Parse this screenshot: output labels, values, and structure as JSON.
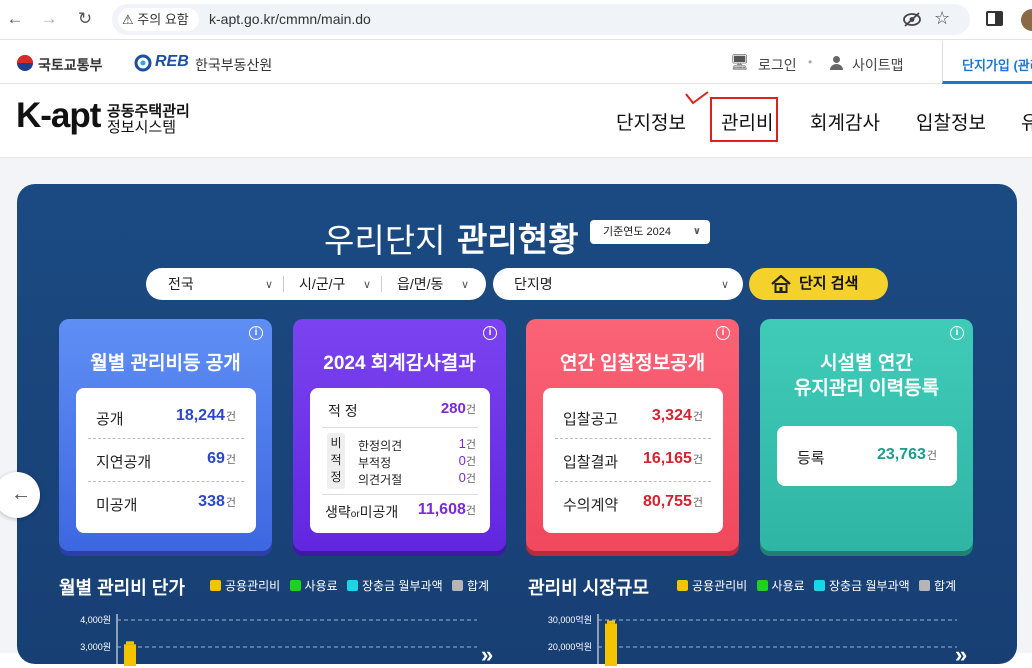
{
  "browser": {
    "warning": "주의 요함",
    "url": "k-apt.go.kr/cmmn/main.do"
  },
  "util": {
    "ministry": "국토교통부",
    "reb_logo": "REB",
    "reb_name": "한국부동산원",
    "login": "로그인",
    "sitemap": "사이트맵",
    "join": "단지가입 (관리"
  },
  "header": {
    "logo_main": "K-apt",
    "logo_line1": "공동주택관리",
    "logo_line2": "정보시스템",
    "menu": [
      "단지정보",
      "관리비",
      "회계감사",
      "입찰정보",
      "유"
    ]
  },
  "hero": {
    "title_light": "우리단지",
    "title_bold": "관리현황",
    "year_select": "기준연도 2024",
    "region1": "전국",
    "region2": "시/군/구",
    "region3": "읍/면/동",
    "complex": "단지명",
    "search_button": "단지 검색"
  },
  "cards": {
    "fee": {
      "title": "월별 관리비등 공개",
      "rows": [
        {
          "label": "공개",
          "value": "18,244",
          "unit": "건"
        },
        {
          "label": "지연공개",
          "value": "69",
          "unit": "건"
        },
        {
          "label": "미공개",
          "value": "338",
          "unit": "건"
        }
      ]
    },
    "audit": {
      "title": "2024 회계감사결과",
      "proper_label": "적 정",
      "proper_value": "280",
      "non_label_chars": [
        "비",
        "적",
        "정"
      ],
      "sub": [
        {
          "label": "한정의견",
          "value": "1"
        },
        {
          "label": "부적정",
          "value": "0"
        },
        {
          "label": "의견거절",
          "value": "0"
        }
      ],
      "omit_label": "생략",
      "or": "or",
      "nondisc_label": "미공개",
      "omit_value": "11,608",
      "unit": "건"
    },
    "bid": {
      "title": "연간 입찰정보공개",
      "rows": [
        {
          "label": "입찰공고",
          "value": "3,324",
          "unit": "건"
        },
        {
          "label": "입찰결과",
          "value": "16,165",
          "unit": "건"
        },
        {
          "label": "수의계약",
          "value": "80,755",
          "unit": "건"
        }
      ]
    },
    "facility": {
      "title_line1": "시설별 연간",
      "title_line2": "유지관리 이력등록",
      "row": {
        "label": "등록",
        "value": "23,763",
        "unit": "건"
      }
    }
  },
  "charts": {
    "left_title": "월별 관리비 단가",
    "right_title": "관리비 시장규모",
    "legend": [
      "공용관리비",
      "사용료",
      "장충금 월부과액",
      "합계"
    ],
    "legend_colors": [
      "#f5c400",
      "#1fd11f",
      "#19d7e6",
      "#b5b5b5"
    ],
    "left_ticks": [
      "4,000원",
      "3,000원"
    ],
    "right_ticks": [
      "30,000억원",
      "20,000억원"
    ]
  },
  "chart_data": [
    {
      "type": "bar",
      "title": "월별 관리비 단가",
      "series": [
        {
          "name": "공용관리비",
          "values": [
            3100
          ]
        },
        {
          "name": "사용료",
          "values": []
        },
        {
          "name": "장충금 월부과액",
          "values": []
        },
        {
          "name": "합계",
          "values": []
        }
      ],
      "ylim": [
        0,
        4000
      ],
      "ticks": [
        "4,000원",
        "3,000원"
      ]
    },
    {
      "type": "bar",
      "title": "관리비 시장규모",
      "series": [
        {
          "name": "공용관리비",
          "values": [
            29000
          ]
        },
        {
          "name": "사용료",
          "values": []
        },
        {
          "name": "장충금 월부과액",
          "values": []
        },
        {
          "name": "합계",
          "values": []
        }
      ],
      "ylim": [
        0,
        30000
      ],
      "ticks": [
        "30,000억원",
        "20,000억원"
      ]
    }
  ]
}
